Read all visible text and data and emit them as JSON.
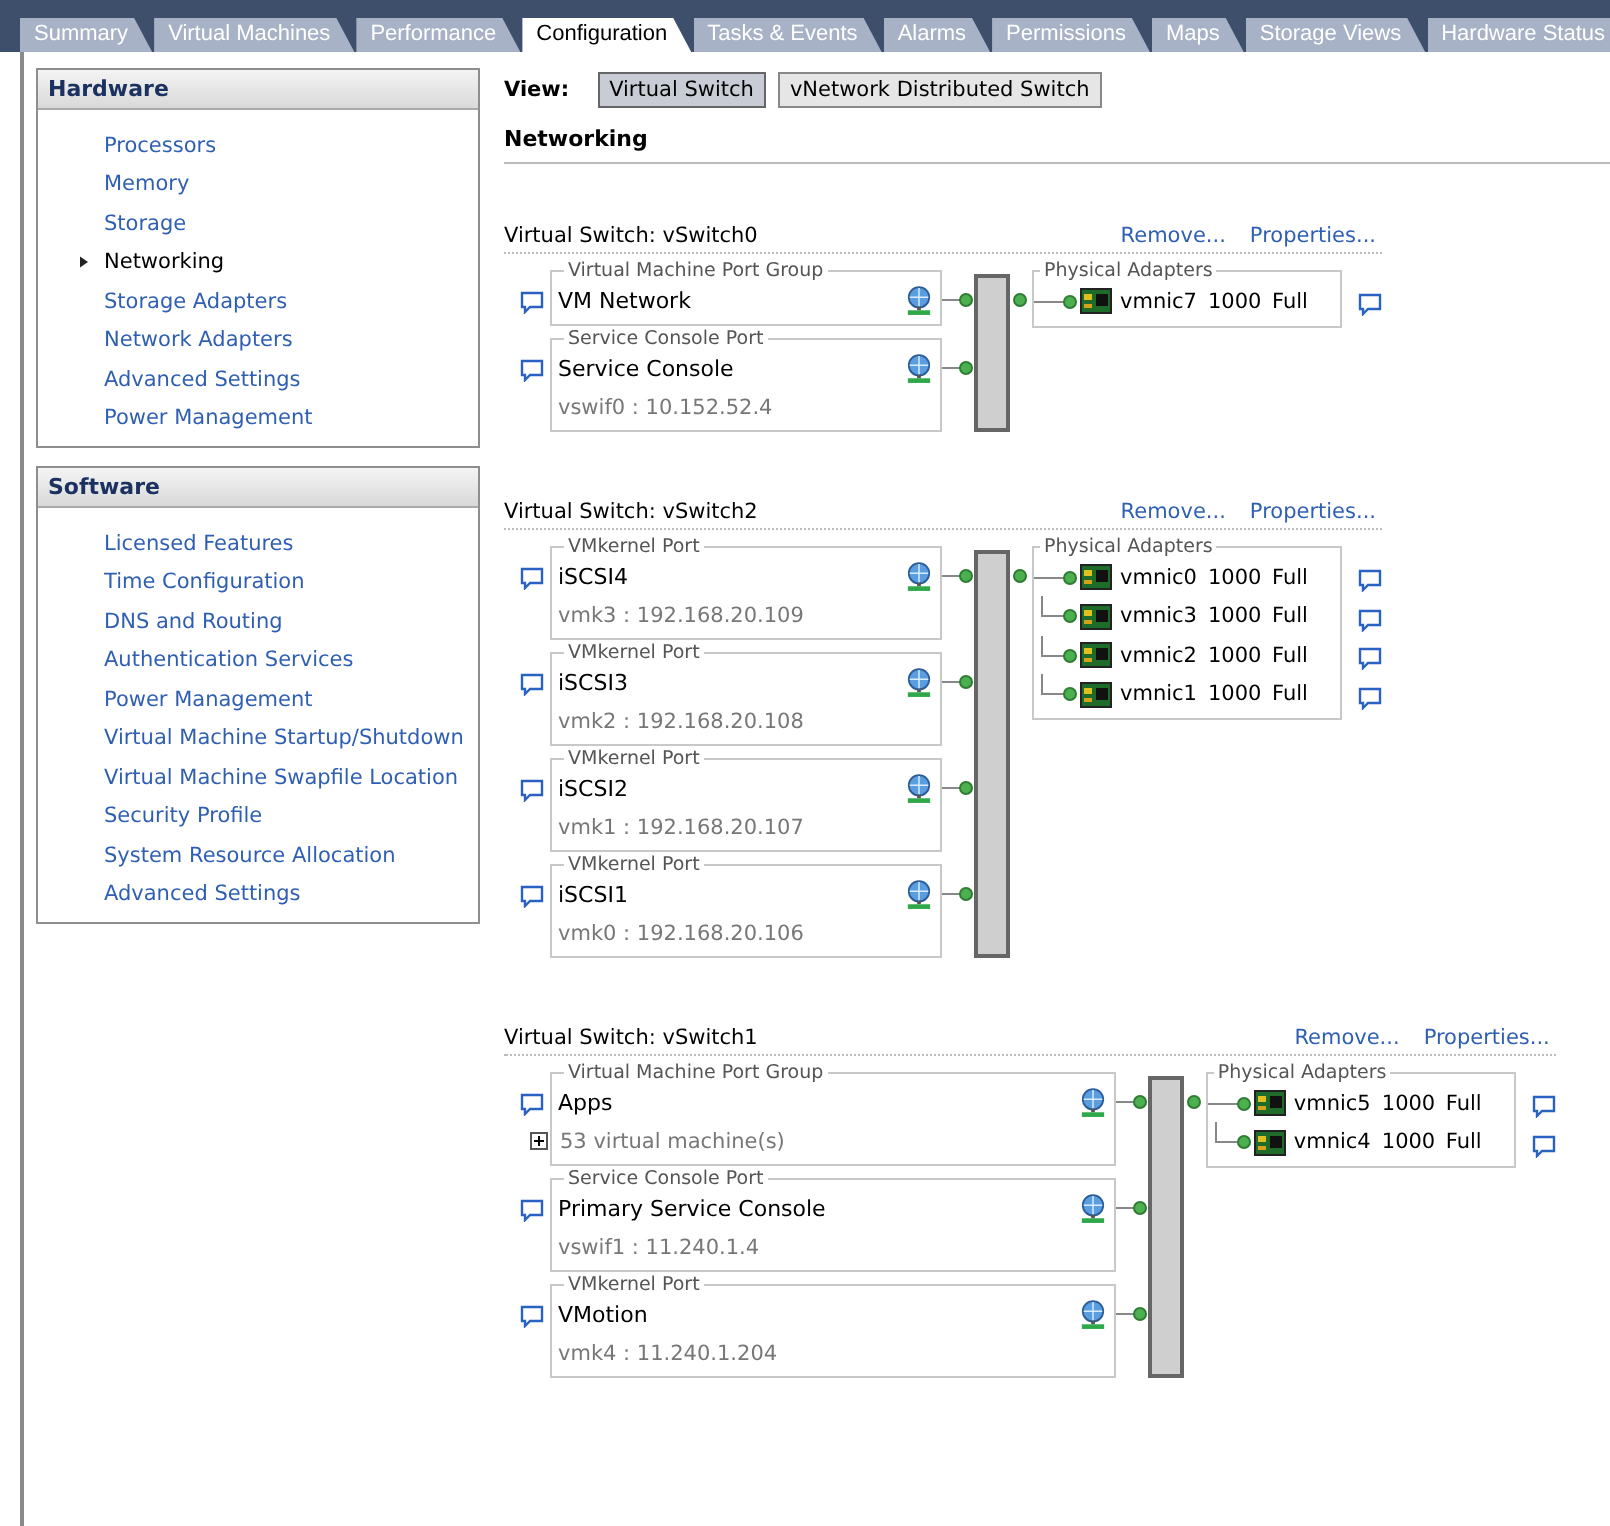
{
  "tabs": [
    {
      "label": "Summary",
      "selected": false
    },
    {
      "label": "Virtual Machines",
      "selected": false
    },
    {
      "label": "Performance",
      "selected": false
    },
    {
      "label": "Configuration",
      "selected": true
    },
    {
      "label": "Tasks & Events",
      "selected": false
    },
    {
      "label": "Alarms",
      "selected": false
    },
    {
      "label": "Permissions",
      "selected": false
    },
    {
      "label": "Maps",
      "selected": false
    },
    {
      "label": "Storage Views",
      "selected": false
    },
    {
      "label": "Hardware Status",
      "selected": false
    }
  ],
  "sidebar": {
    "sections": [
      {
        "title": "Hardware",
        "items": [
          {
            "label": "Processors",
            "selected": false
          },
          {
            "label": "Memory",
            "selected": false
          },
          {
            "label": "Storage",
            "selected": false
          },
          {
            "label": "Networking",
            "selected": true
          },
          {
            "label": "Storage Adapters",
            "selected": false
          },
          {
            "label": "Network Adapters",
            "selected": false
          },
          {
            "label": "Advanced Settings",
            "selected": false
          },
          {
            "label": "Power Management",
            "selected": false
          }
        ]
      },
      {
        "title": "Software",
        "items": [
          {
            "label": "Licensed Features",
            "selected": false
          },
          {
            "label": "Time Configuration",
            "selected": false
          },
          {
            "label": "DNS and Routing",
            "selected": false
          },
          {
            "label": "Authentication Services",
            "selected": false
          },
          {
            "label": "Power Management",
            "selected": false
          },
          {
            "label": "Virtual Machine Startup/Shutdown",
            "selected": false
          },
          {
            "label": "Virtual Machine Swapfile Location",
            "selected": false
          },
          {
            "label": "Security Profile",
            "selected": false
          },
          {
            "label": "System Resource Allocation",
            "selected": false
          },
          {
            "label": "Advanced Settings",
            "selected": false
          }
        ]
      }
    ]
  },
  "view": {
    "label": "View:",
    "options": [
      {
        "label": "Virtual Switch",
        "selected": true
      },
      {
        "label": "vNetwork Distributed Switch",
        "selected": false
      }
    ]
  },
  "heading": "Networking",
  "switches": [
    {
      "title": "Virtual Switch: vSwitch0",
      "actions": [
        "Remove...",
        "Properties..."
      ],
      "ports": [
        {
          "group": "Virtual Machine Port Group",
          "name": "VM Network"
        },
        {
          "group": "Service Console Port",
          "name": "Service Console",
          "detail": "vswif0 : 10.152.52.4"
        }
      ],
      "adapters_label": "Physical Adapters",
      "adapters": [
        {
          "name": "vmnic7",
          "speed": "1000",
          "duplex": "Full"
        }
      ]
    },
    {
      "title": "Virtual Switch: vSwitch2",
      "actions": [
        "Remove...",
        "Properties..."
      ],
      "ports": [
        {
          "group": "VMkernel Port",
          "name": "iSCSI4",
          "detail": "vmk3 : 192.168.20.109"
        },
        {
          "group": "VMkernel Port",
          "name": "iSCSI3",
          "detail": "vmk2 : 192.168.20.108"
        },
        {
          "group": "VMkernel Port",
          "name": "iSCSI2",
          "detail": "vmk1 : 192.168.20.107"
        },
        {
          "group": "VMkernel Port",
          "name": "iSCSI1",
          "detail": "vmk0 : 192.168.20.106"
        }
      ],
      "adapters_label": "Physical Adapters",
      "adapters": [
        {
          "name": "vmnic0",
          "speed": "1000",
          "duplex": "Full"
        },
        {
          "name": "vmnic3",
          "speed": "1000",
          "duplex": "Full"
        },
        {
          "name": "vmnic2",
          "speed": "1000",
          "duplex": "Full"
        },
        {
          "name": "vmnic1",
          "speed": "1000",
          "duplex": "Full"
        }
      ]
    },
    {
      "title": "Virtual Switch: vSwitch1",
      "actions": [
        "Remove...",
        "Properties..."
      ],
      "ports": [
        {
          "group": "Virtual Machine Port Group",
          "name": "Apps",
          "detail": "53 virtual machine(s)",
          "expanded": false
        },
        {
          "group": "Service Console Port",
          "name": "Primary Service Console",
          "detail": "vswif1 : 11.240.1.4"
        },
        {
          "group": "VMkernel Port",
          "name": "VMotion",
          "detail": "vmk4 : 11.240.1.204"
        }
      ],
      "adapters_label": "Physical Adapters",
      "adapters": [
        {
          "name": "vmnic5",
          "speed": "1000",
          "duplex": "Full"
        },
        {
          "name": "vmnic4",
          "speed": "1000",
          "duplex": "Full"
        }
      ]
    }
  ]
}
